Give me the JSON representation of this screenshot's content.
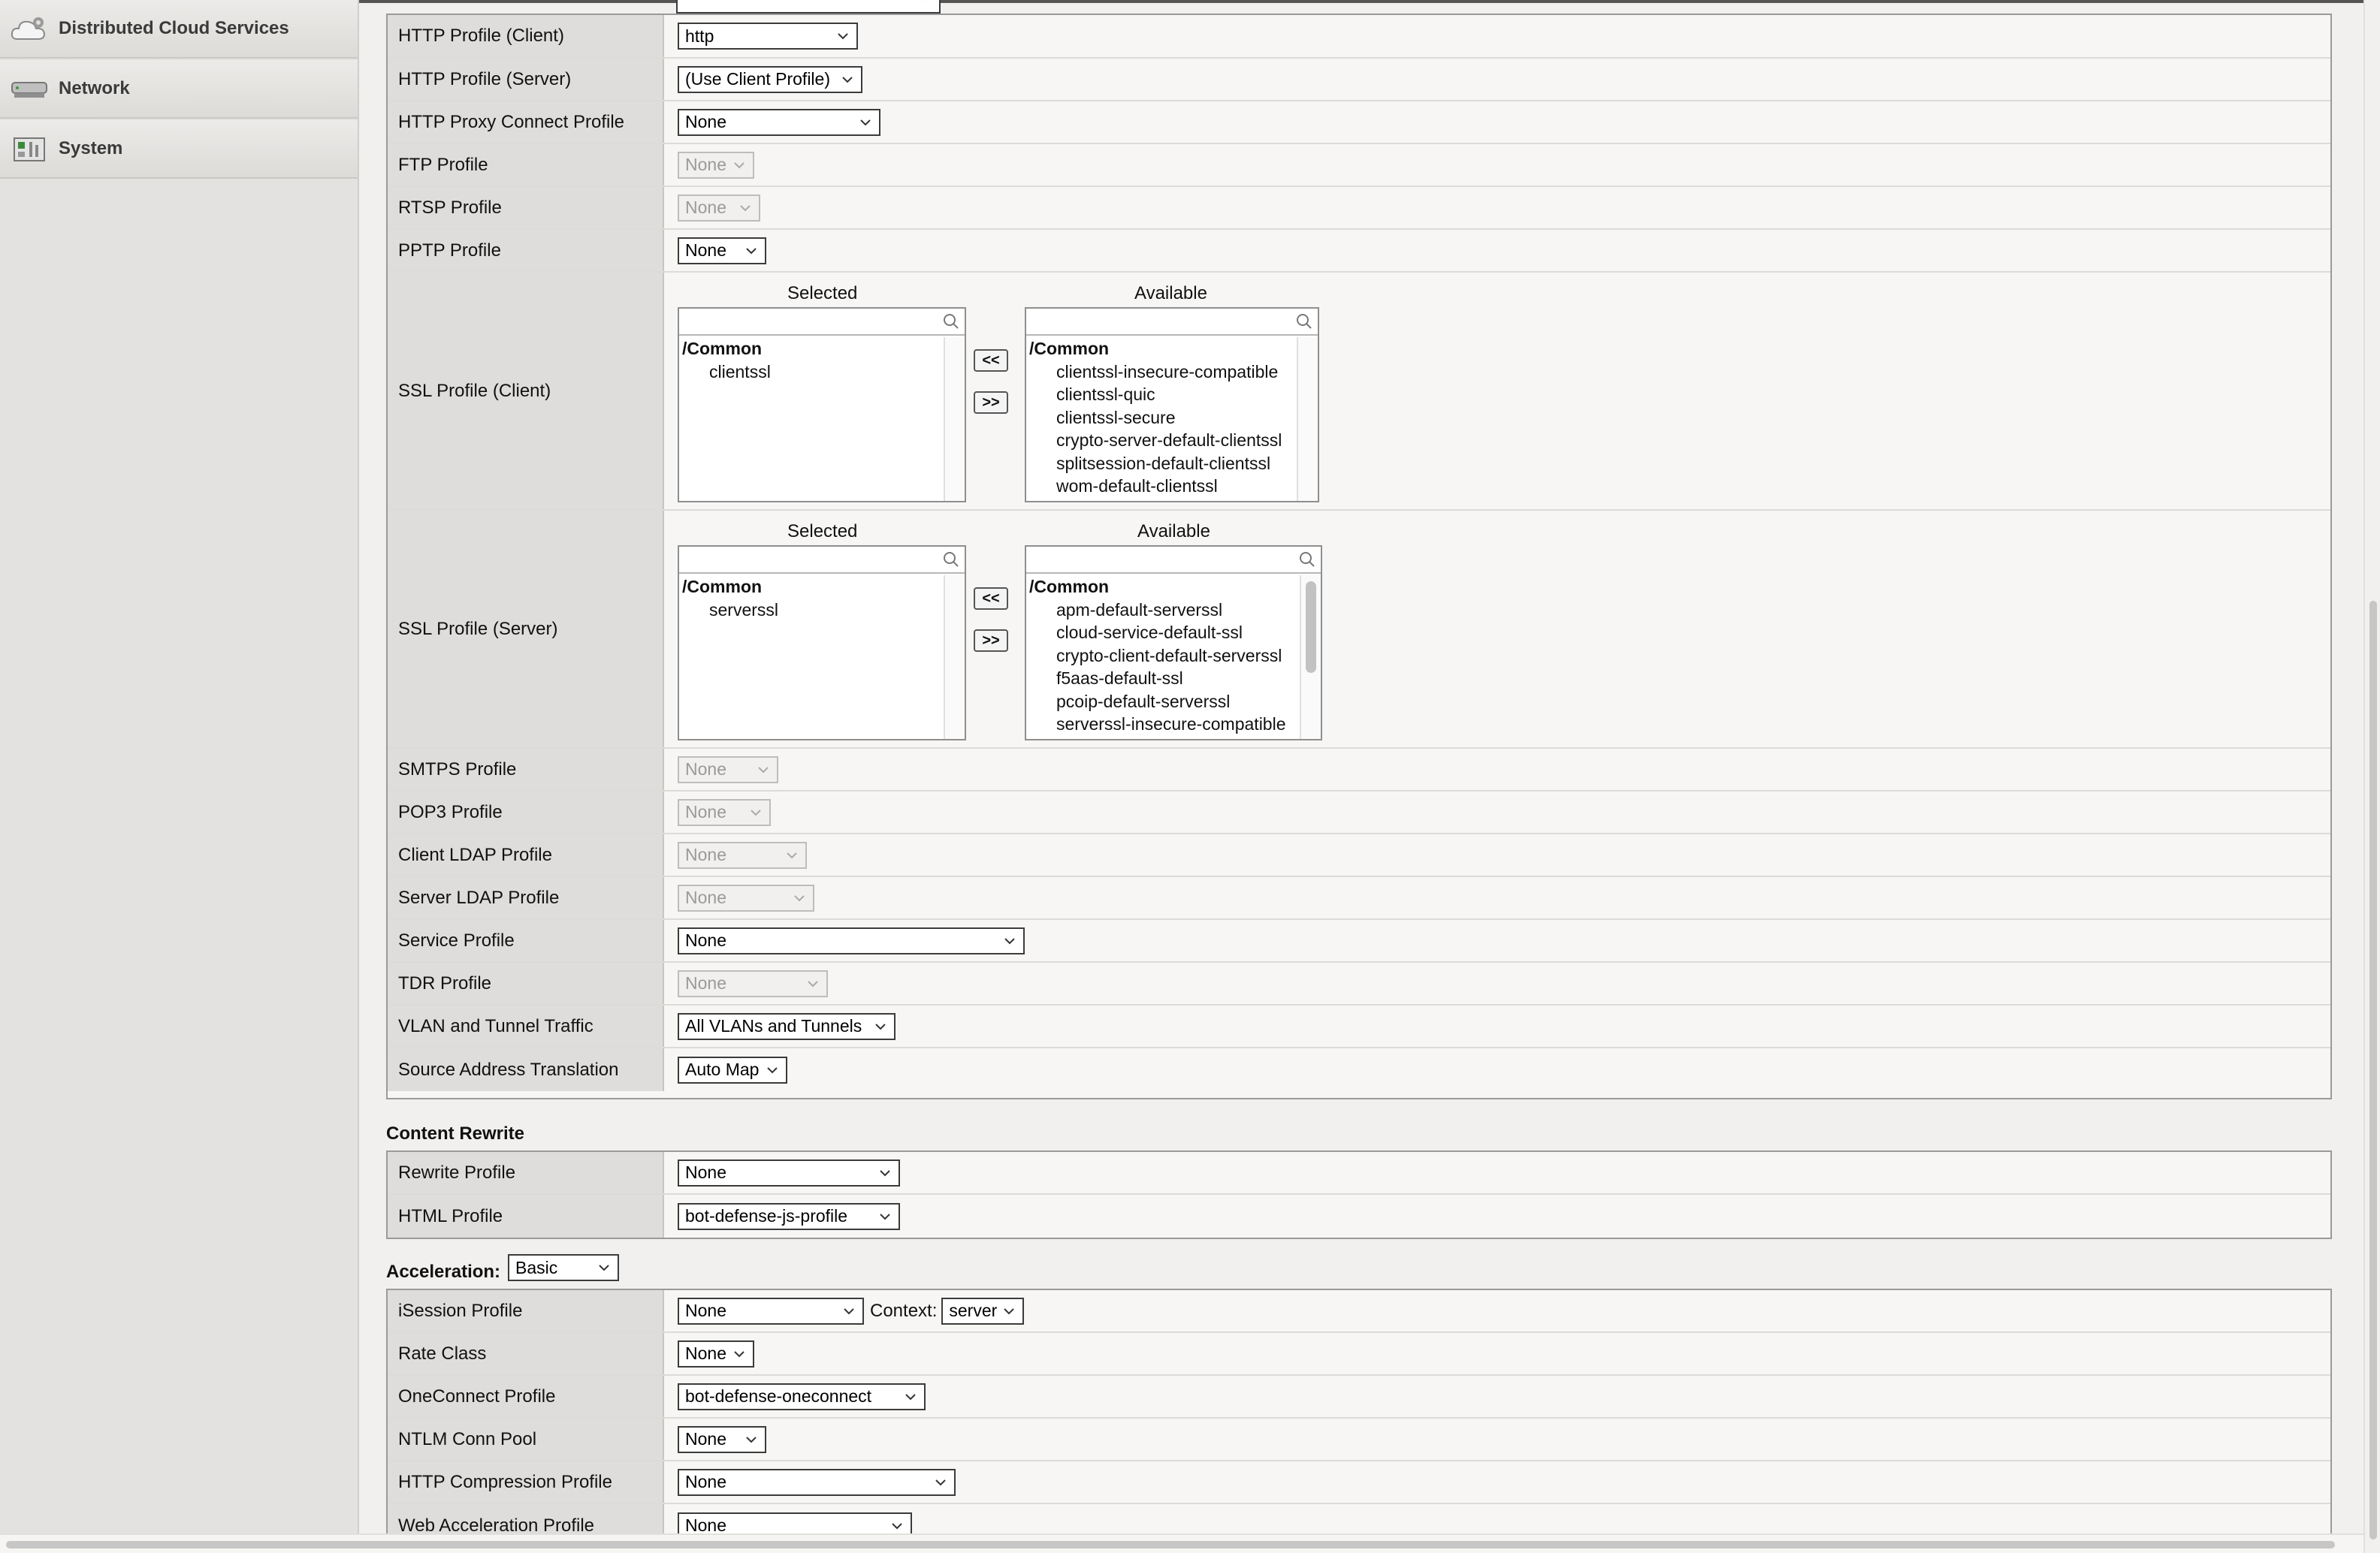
{
  "sidebar": {
    "items": [
      {
        "label": "Distributed Cloud Services",
        "icon": "cloud-gear-icon"
      },
      {
        "label": "Network",
        "icon": "network-device-icon"
      },
      {
        "label": "System",
        "icon": "system-panel-icon"
      }
    ]
  },
  "config": {
    "rows": [
      {
        "label": "HTTP Profile (Client)",
        "value": "http"
      },
      {
        "label": "HTTP Profile (Server)",
        "value": "(Use Client Profile)"
      },
      {
        "label": "HTTP Proxy Connect Profile",
        "value": "None"
      },
      {
        "label": "FTP Profile",
        "value": "None",
        "disabled": true
      },
      {
        "label": "RTSP Profile",
        "value": "None",
        "disabled": true
      },
      {
        "label": "PPTP Profile",
        "value": "None"
      },
      {
        "label": "SMTPS Profile",
        "value": "None",
        "disabled": true
      },
      {
        "label": "POP3 Profile",
        "value": "None",
        "disabled": true
      },
      {
        "label": "Client LDAP Profile",
        "value": "None",
        "disabled": true
      },
      {
        "label": "Server LDAP Profile",
        "value": "None",
        "disabled": true
      },
      {
        "label": "Service Profile",
        "value": "None"
      },
      {
        "label": "TDR Profile",
        "value": "None",
        "disabled": true
      },
      {
        "label": "VLAN and Tunnel Traffic",
        "value": "All VLANs and Tunnels"
      },
      {
        "label": "Source Address Translation",
        "value": "Auto Map"
      }
    ],
    "ssl_client": {
      "label": "SSL Profile (Client)",
      "selected_header": "Selected",
      "available_header": "Available",
      "move_left": "<<",
      "move_right": ">>",
      "selected_group": "/Common",
      "selected_items": [
        "clientssl"
      ],
      "available_group": "/Common",
      "available_items": [
        "clientssl-insecure-compatible",
        "clientssl-quic",
        "clientssl-secure",
        "crypto-server-default-clientssl",
        "splitsession-default-clientssl",
        "wom-default-clientssl"
      ]
    },
    "ssl_server": {
      "label": "SSL Profile (Server)",
      "selected_header": "Selected",
      "available_header": "Available",
      "move_left": "<<",
      "move_right": ">>",
      "selected_group": "/Common",
      "selected_items": [
        "serverssl"
      ],
      "available_group": "/Common",
      "available_items": [
        "apm-default-serverssl",
        "cloud-service-default-ssl",
        "crypto-client-default-serverssl",
        "f5aas-default-ssl",
        "pcoip-default-serverssl",
        "serverssl-insecure-compatible"
      ]
    }
  },
  "content_rewrite": {
    "title": "Content Rewrite",
    "rows": [
      {
        "label": "Rewrite Profile",
        "value": "None"
      },
      {
        "label": "HTML Profile",
        "value": "bot-defense-js-profile"
      }
    ]
  },
  "acceleration": {
    "title": "Acceleration:",
    "mode": "Basic",
    "context_label": "Context:",
    "context_value": "server",
    "rows": [
      {
        "label": "iSession Profile",
        "value": "None"
      },
      {
        "label": "Rate Class",
        "value": "None"
      },
      {
        "label": "OneConnect Profile",
        "value": "bot-defense-oneconnect"
      },
      {
        "label": "NTLM Conn Pool",
        "value": "None"
      },
      {
        "label": "HTTP Compression Profile",
        "value": "None"
      },
      {
        "label": "Web Acceleration Profile",
        "value": "None"
      }
    ]
  },
  "colors": {
    "label_bg": "#dedddb",
    "border": "#9a9a9a",
    "sidebar_bg": "#e3e2e0"
  }
}
